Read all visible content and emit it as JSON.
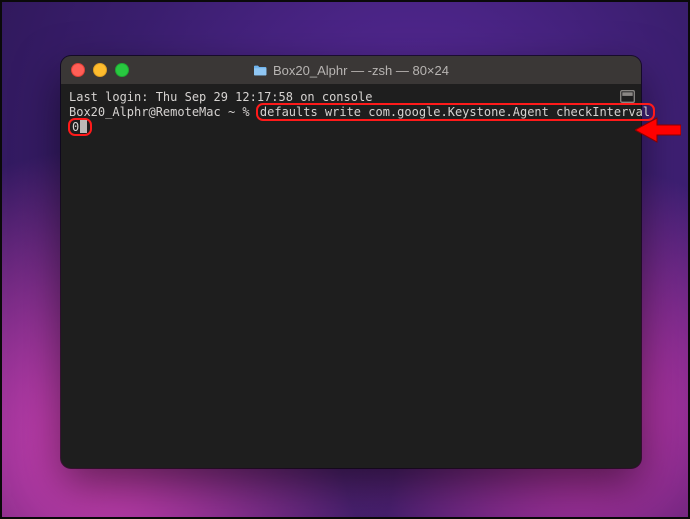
{
  "window": {
    "title": "Box20_Alphr — -zsh — 80×24"
  },
  "terminal": {
    "last_login": "Last login: Thu Sep 29 12:17:58 on console",
    "prompt_user_host": "Box20_Alphr@RemoteMac",
    "prompt_path": "~",
    "prompt_symbol": "%",
    "command_part1": "defaults write com.google.Keystone.Agent checkInterval",
    "command_part2": "0"
  },
  "icons": {
    "folder": "folder-icon",
    "pane": "pane-split-icon"
  },
  "annotation": {
    "arrow": "red-callout-arrow"
  },
  "colors": {
    "highlight": "#ff1a1a",
    "terminal_bg": "#1e1e1e",
    "terminal_fg": "#d6d3d1"
  }
}
